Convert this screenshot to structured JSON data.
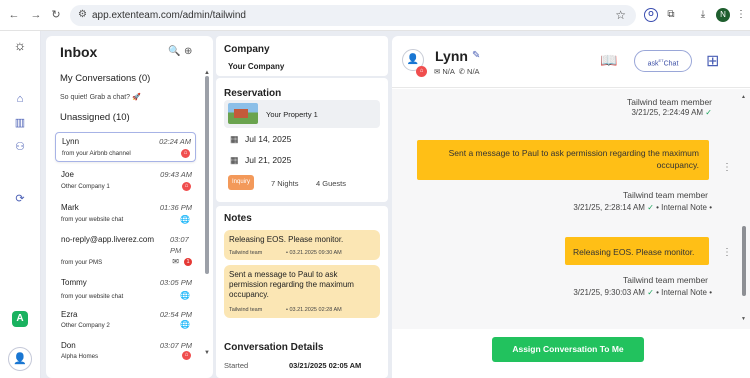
{
  "browser": {
    "url": "app.extenteam.com/admin/tailwind",
    "profile_initial": "N",
    "ext_label": "O"
  },
  "inbox": {
    "title": "Inbox",
    "my_conversations": "My Conversations (0)",
    "quiet_text": "So quiet! Grab a chat?",
    "quiet_emoji": "🚀",
    "unassigned": "Unassigned (10)",
    "conversations": [
      {
        "name": "Lynn",
        "time": "02:24 AM",
        "sub": "from your Airbnb channel",
        "channel": "airbnb"
      },
      {
        "name": "Joe",
        "time": "09:43 AM",
        "sub": "Other Company 1",
        "channel": "airbnb"
      },
      {
        "name": "Mark",
        "time": "01:36 PM",
        "sub": "from your website chat",
        "channel": "web"
      },
      {
        "name": "no-reply@app.liverez.com",
        "time": "03:07 PM",
        "sub": "from your PMS",
        "channel": "pms",
        "unread": "1"
      },
      {
        "name": "Tommy",
        "time": "03:05 PM",
        "sub": "from your website chat",
        "channel": "web"
      },
      {
        "name": "Ezra",
        "time": "02:54 PM",
        "sub": "Other Company 2",
        "channel": "web"
      },
      {
        "name": "Don",
        "time": "03:07 PM",
        "sub": "Alpha Homes",
        "channel": "airbnb"
      }
    ]
  },
  "details": {
    "company_label": "Company",
    "company_value": "Your Company",
    "reservation_label": "Reservation",
    "property_name": "Your Property 1",
    "checkin": "Jul 14, 2025",
    "checkout": "Jul 21, 2025",
    "status_tag": "Inquiry",
    "nights": "7 Nights",
    "guests": "4 Guests",
    "notes_label": "Notes",
    "notes": [
      {
        "text": "Releasing EOS. Please monitor.",
        "by": "Tailwind team",
        "at": "• 03.21.2025 09:30 AM"
      },
      {
        "text": "Sent a message to Paul to ask permission regarding the maximum occupancy.",
        "by": "Tailwind team",
        "at": "• 03.21.2025 02:28 AM"
      }
    ],
    "conv_details_label": "Conversation Details",
    "started_label": "Started",
    "started_value": "03/21/2025 02:05 AM"
  },
  "chat": {
    "name": "Lynn",
    "email": "N/A",
    "phone": "N/A",
    "ask_button": "ask",
    "ask_button_sup": "ET",
    "ask_button_tail": "Chat",
    "messages": [
      {
        "sender": "Tailwind team member",
        "stamp": "3/21/25, 2:24:49 AM",
        "text": ""
      },
      {
        "text": "Sent a message to Paul to ask permission regarding the maximum occupancy.",
        "sender": "Tailwind team member",
        "stamp": "3/21/25, 2:28:14 AM",
        "suffix": "• Internal Note •"
      },
      {
        "text": "Releasing EOS. Please monitor.",
        "sender": "Tailwind team member",
        "stamp": "3/21/25, 9:30:03 AM",
        "suffix": "• Internal Note •"
      }
    ],
    "assign_button": "Assign Conversation To Me"
  }
}
